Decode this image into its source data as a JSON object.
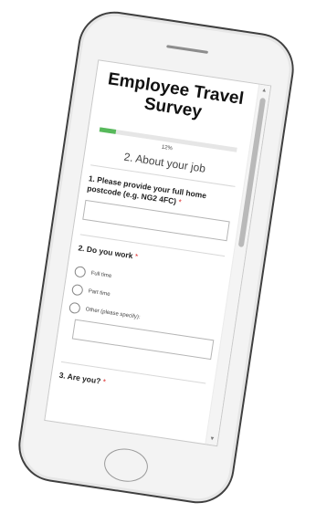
{
  "survey": {
    "title": "Employee Travel Survey",
    "progress": {
      "percent": 12,
      "label": "12%",
      "accent_color": "#57b95b"
    },
    "section_title": "2. About your job"
  },
  "questions": {
    "q1": {
      "text": "1. Please provide your full home postcode (e.g. NG2 4FC)",
      "required_mark": "*",
      "value": ""
    },
    "q2": {
      "text": "2. Do you work",
      "required_mark": "*",
      "options": [
        "Full time",
        "Part time",
        "Other (please specify):"
      ],
      "other_value": ""
    },
    "q3": {
      "text": "3. Are you?",
      "required_mark": "*"
    }
  },
  "icons": {
    "scroll_up": "arrow-up-icon",
    "scroll_down": "arrow-down-icon"
  }
}
